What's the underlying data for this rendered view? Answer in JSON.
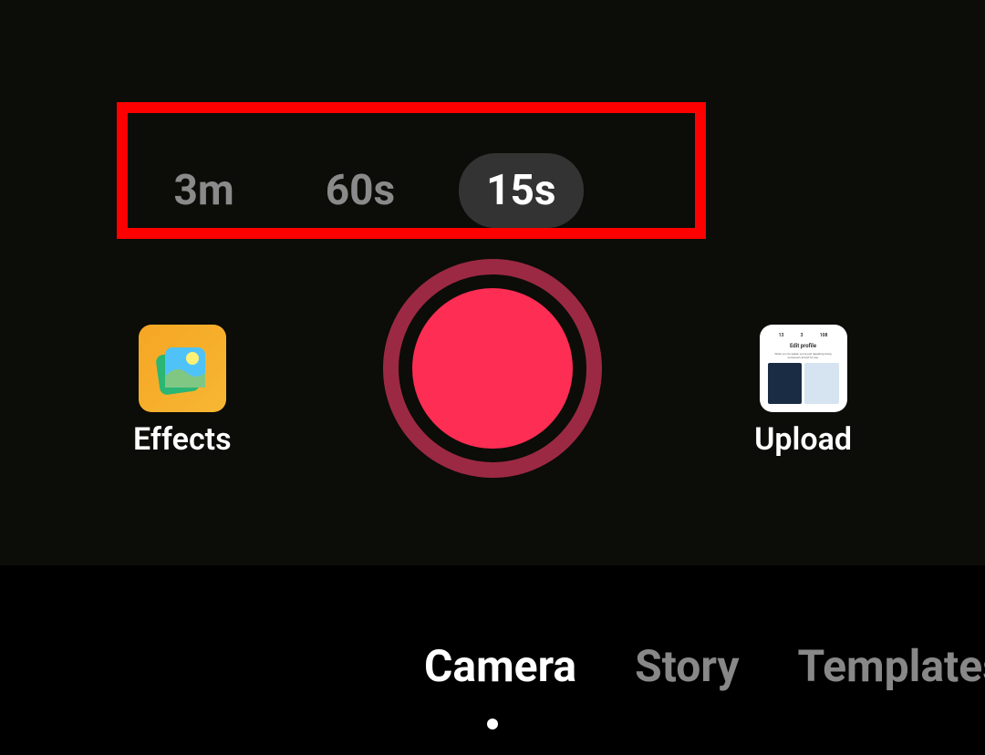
{
  "duration": {
    "options": [
      {
        "label": "3m",
        "active": false
      },
      {
        "label": "60s",
        "active": false
      },
      {
        "label": "15s",
        "active": true
      }
    ]
  },
  "controls": {
    "effects_label": "Effects",
    "upload_label": "Upload"
  },
  "modes": {
    "tabs": [
      {
        "label": "Camera",
        "active": true
      },
      {
        "label": "Story",
        "active": false
      },
      {
        "label": "Templates",
        "active": false
      }
    ]
  },
  "highlight": {
    "visible": true
  },
  "colors": {
    "record_primary": "#fe2d54",
    "record_ring": "#9c2943",
    "highlight_border": "#ff0000"
  }
}
